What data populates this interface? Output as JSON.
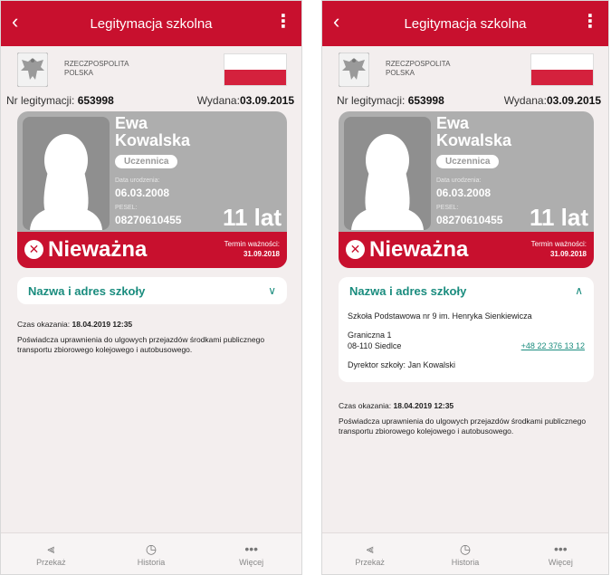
{
  "app": {
    "title": "Legitymacja szkolna",
    "header_line1": "RZECZPOSPOLITA",
    "header_line2": "POLSKA"
  },
  "id": {
    "nr_label": "Nr legitymacji:",
    "nr_value": "653998",
    "issued_label": "Wydana:",
    "issued_value": "03.09.2015"
  },
  "card": {
    "first_name": "Ewa",
    "last_name": "Kowalska",
    "role": "Uczennica",
    "dob_label": "Data urodzenia:",
    "dob_value": "06.03.2008",
    "pesel_label": "PESEL:",
    "pesel_value": "08270610455",
    "age": "11 lat",
    "status": "Nieważna",
    "validity_label": "Termin ważności:",
    "validity_value": "31.09.2018"
  },
  "school": {
    "header": "Nazwa i adres szkoły",
    "name": "Szkoła Podstawowa nr 9 im. Henryka Sienkiewicza",
    "street": "Graniczna 1",
    "city": "08-110 Siedlce",
    "phone": "+48 22 376 13 12",
    "director": "Dyrektor szkoły: Jan Kowalski"
  },
  "info": {
    "time_label": "Czas okazania:",
    "time_value": "18.04.2019 12:35",
    "text": "Poświadcza uprawnienia do ulgowych przejazdów środkami publicznego transportu zbiorowego kolejowego i autobusowego."
  },
  "bottom": {
    "share": "Przekaż",
    "history": "Historia",
    "more": "Więcej"
  },
  "colors": {
    "brand_red": "#c8102e",
    "teal": "#1a8c7e",
    "card_gray": "#aeaeae"
  }
}
